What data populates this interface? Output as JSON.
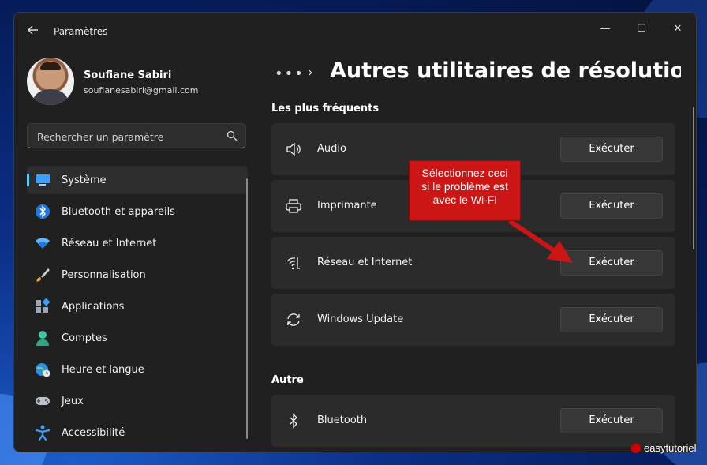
{
  "window": {
    "title": "Paramètres",
    "controls": {
      "minimize": "—",
      "maximize": "☐",
      "close": "✕"
    }
  },
  "profile": {
    "name": "Soufiane Sabiri",
    "email": "soufianesabiri@gmail.com"
  },
  "search": {
    "placeholder": "Rechercher un paramètre"
  },
  "sidebar": {
    "items": [
      {
        "label": "Système",
        "icon": "monitor-icon",
        "active": true
      },
      {
        "label": "Bluetooth et appareils",
        "icon": "bluetooth-icon"
      },
      {
        "label": "Réseau et Internet",
        "icon": "wifi-icon"
      },
      {
        "label": "Personnalisation",
        "icon": "brush-icon"
      },
      {
        "label": "Applications",
        "icon": "apps-icon"
      },
      {
        "label": "Comptes",
        "icon": "person-icon"
      },
      {
        "label": "Heure et langue",
        "icon": "globe-clock-icon"
      },
      {
        "label": "Jeux",
        "icon": "gamepad-icon"
      },
      {
        "label": "Accessibilité",
        "icon": "accessibility-icon"
      }
    ]
  },
  "main": {
    "breadcrumb_more": "•••",
    "breadcrumb_sep": "›",
    "title": "Autres utilitaires de résolution des",
    "sections": [
      {
        "title": "Les plus fréquents",
        "items": [
          {
            "label": "Audio",
            "icon": "speaker-icon",
            "button": "Exécuter"
          },
          {
            "label": "Imprimante",
            "icon": "printer-icon",
            "button": "Exécuter"
          },
          {
            "label": "Réseau et Internet",
            "icon": "network-icon",
            "button": "Exécuter"
          },
          {
            "label": "Windows Update",
            "icon": "sync-icon",
            "button": "Exécuter"
          }
        ]
      },
      {
        "title": "Autre",
        "items": [
          {
            "label": "Bluetooth",
            "icon": "bluetooth-icon",
            "button": "Exécuter"
          }
        ]
      }
    ]
  },
  "annotation": {
    "line1": "Sélectionnez ceci",
    "line2": "si le problème est",
    "line3": "avec le Wi-Fi",
    "color": "#cc1616"
  },
  "watermark": {
    "text": "easytutoriel"
  },
  "colors": {
    "accent": "#60cdff",
    "window_bg": "#202020",
    "card_bg": "#2b2b2b"
  }
}
